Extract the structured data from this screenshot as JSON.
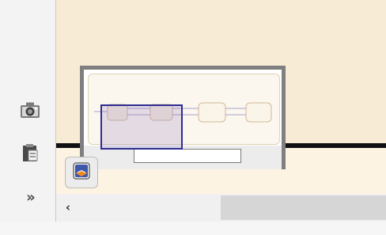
{
  "toolbar": {
    "icons": [
      "camera-icon",
      "clipboard-icon"
    ],
    "more_label": "»"
  },
  "canvas": {
    "background": "#f7ebd6"
  },
  "overview": {
    "toggle_icon": "overview-map-icon",
    "flow_shapes": 4
  },
  "scrollbar": {
    "left_arrow": "‹"
  }
}
